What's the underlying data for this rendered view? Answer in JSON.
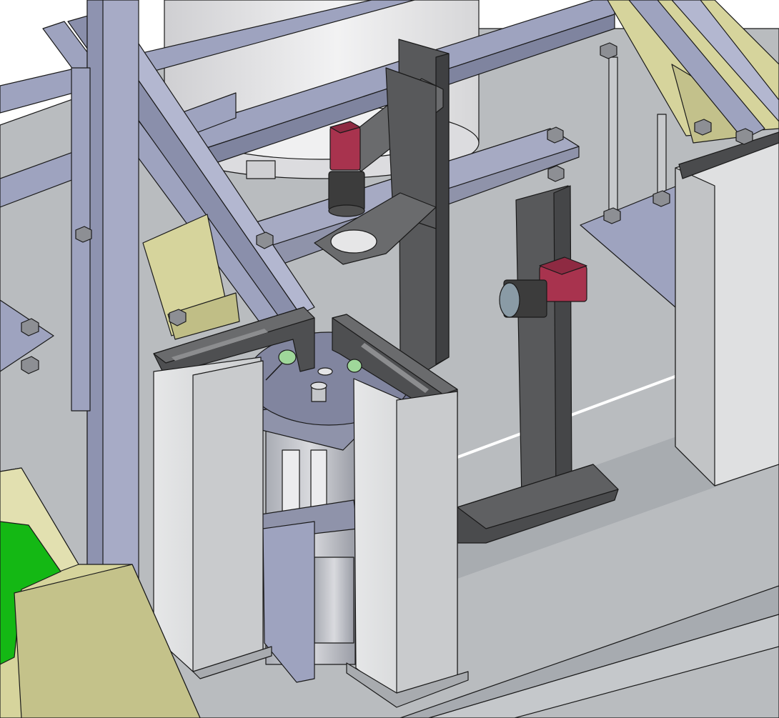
{
  "scene": {
    "subject": "isometric-cad-assembly",
    "colors": {
      "background": "#ffffff",
      "base_plate": "#b9bcbf",
      "frame_steel": "#9ea3bf",
      "bracket_dark": "#58595b",
      "pillar_light": "#d5d7d9",
      "tank": "#e4e4e6",
      "cream_block": "#d6d49c",
      "camera_red": "#a8334e",
      "lens_dark": "#3c3c3c",
      "pcb_green": "#14b814",
      "nozzle_green": "#9fd79a"
    },
    "icons": [
      "camera-icon",
      "lens-icon",
      "bolt-icon",
      "nozzle-icon"
    ]
  }
}
